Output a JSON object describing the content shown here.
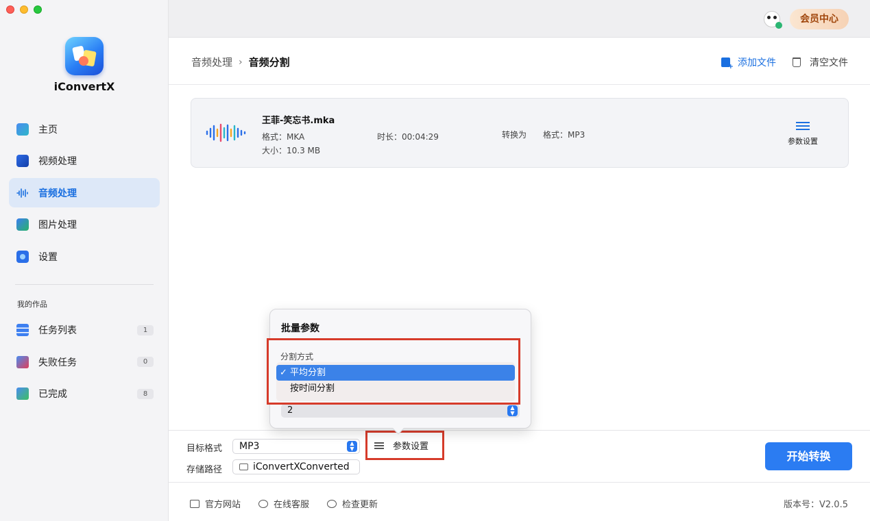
{
  "app": {
    "name": "iConvertX"
  },
  "topbar": {
    "vip_label": "会员中心"
  },
  "sidebar": {
    "items": [
      {
        "label": "主页",
        "icon": "home-icon"
      },
      {
        "label": "视频处理",
        "icon": "video-icon"
      },
      {
        "label": "音频处理",
        "icon": "audio-wave-icon",
        "active": true
      },
      {
        "label": "图片处理",
        "icon": "image-icon"
      },
      {
        "label": "设置",
        "icon": "gear-icon"
      }
    ],
    "my_works_label": "我的作品",
    "works": [
      {
        "label": "任务列表",
        "count": "1"
      },
      {
        "label": "失败任务",
        "count": "0"
      },
      {
        "label": "已完成",
        "count": "8"
      }
    ]
  },
  "header": {
    "breadcrumb_parent": "音频处理",
    "breadcrumb_sep": "›",
    "breadcrumb_current": "音频分割",
    "add_file_label": "添加文件",
    "clear_file_label": "清空文件"
  },
  "file": {
    "name": "王菲-笑忘书.mka",
    "format": "格式：MKA",
    "size": "大小：10.3 MB",
    "duration": "时长：00:04:29",
    "convert_to_label": "转换为",
    "target_format": "格式：MP3",
    "settings_label": "参数设置"
  },
  "bottom": {
    "target_format_label": "目标格式",
    "target_format_value": "MP3",
    "save_path_label": "存储路径",
    "save_path_value": "iConvertXConverted",
    "param_settings_label": "参数设置",
    "start_label": "开始转换"
  },
  "popover": {
    "title": "批量参数",
    "split_mode_label": "分割方式",
    "options": [
      {
        "label": "平均分割",
        "selected": true
      },
      {
        "label": "按时间分割",
        "selected": false
      }
    ],
    "check_mark": "✓",
    "count_value": "2"
  },
  "footer": {
    "website_label": "官方网站",
    "support_label": "在线客服",
    "update_label": "检查更新",
    "version_label": "版本号：V2.0.5"
  },
  "colors": {
    "accent": "#2b7cf2",
    "highlight_border": "#d63b2a",
    "vip_text": "#a0460c"
  }
}
